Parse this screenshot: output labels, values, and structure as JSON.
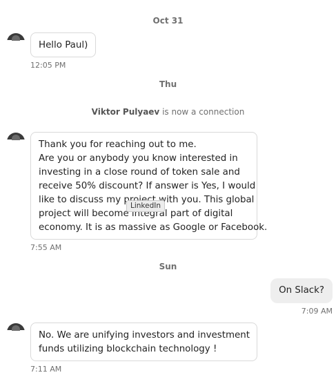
{
  "separators": {
    "oct31": "Oct 31",
    "thu": "Thu",
    "sun": "Sun"
  },
  "connection": {
    "name": "Viktor Pulyaev",
    "text": " is now a connection"
  },
  "messages": [
    {
      "direction": "incoming",
      "lines": [
        "Hello Paul)"
      ],
      "time": "12:05 PM"
    },
    {
      "direction": "incoming",
      "lines": [
        "Thank you for reaching out to me.",
        "Are you or anybody you know interested in",
        "investing in a close round of token sale and",
        "receive 50% discount? If answer is Yes, I would",
        "like to discuss my project with you. This global",
        "project will become integral part of digital",
        "economy. It is as massive as Google or Facebook."
      ],
      "time": "7:55 AM"
    },
    {
      "direction": "outgoing",
      "lines": [
        "On Slack?"
      ],
      "time": "7:09 AM"
    },
    {
      "direction": "incoming",
      "lines": [
        "No. We are unifying investors and investment",
        "funds utilizing blockchain technology !"
      ],
      "time": "7:11 AM"
    }
  ],
  "tooltip": "LinkedIn",
  "icons": {
    "avatar": "sender-avatar-photo"
  }
}
